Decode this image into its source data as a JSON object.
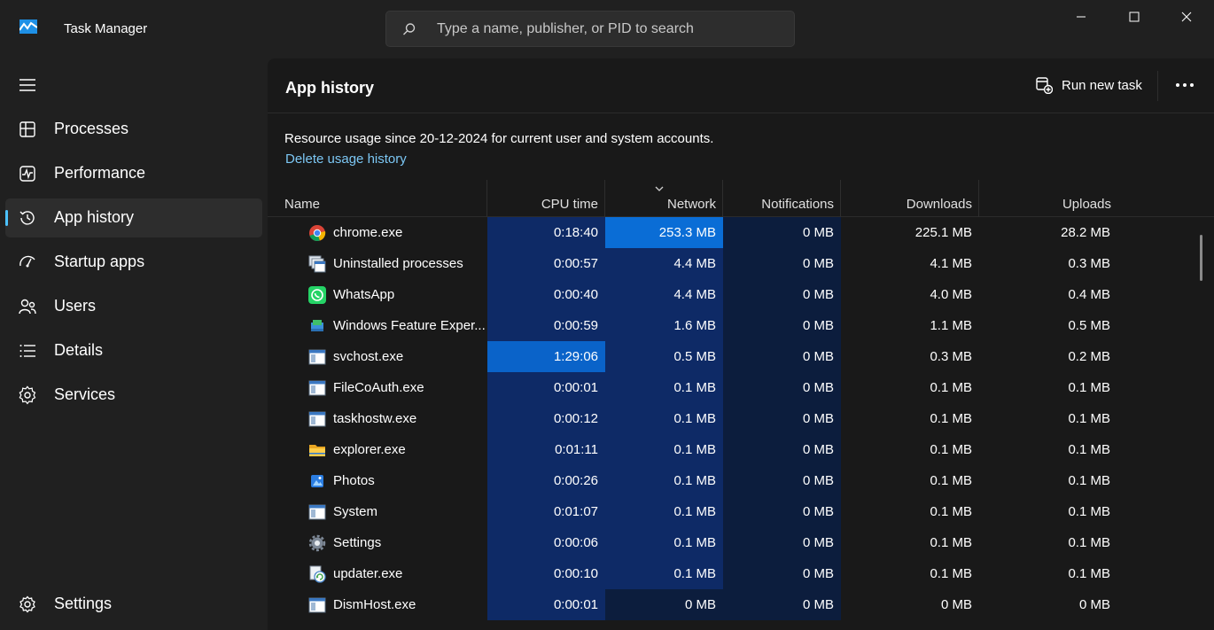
{
  "window": {
    "title": "Task Manager",
    "search_placeholder": "Type a name, publisher, or PID to search"
  },
  "nav": {
    "items": [
      {
        "label": "Processes",
        "icon": "processes-icon"
      },
      {
        "label": "Performance",
        "icon": "performance-icon"
      },
      {
        "label": "App history",
        "icon": "history-icon",
        "active": true
      },
      {
        "label": "Startup apps",
        "icon": "startup-icon"
      },
      {
        "label": "Users",
        "icon": "users-icon"
      },
      {
        "label": "Details",
        "icon": "details-icon"
      },
      {
        "label": "Services",
        "icon": "services-icon"
      }
    ],
    "settings_label": "Settings"
  },
  "header": {
    "title": "App history",
    "run_new_task": "Run new task"
  },
  "info": {
    "text": "Resource usage since 20-12-2024 for current user and system accounts.",
    "delete_link": "Delete usage history"
  },
  "table": {
    "columns": [
      "Name",
      "CPU time",
      "Network",
      "Notifications",
      "Downloads",
      "Uploads"
    ],
    "sorted_column": "Network",
    "rows": [
      {
        "name": "chrome.exe",
        "icon": "chrome-icon",
        "cpu": "0:18:40",
        "network": "253.3 MB",
        "notifications": "0 MB",
        "downloads": "225.1 MB",
        "uploads": "28.2 MB"
      },
      {
        "name": "Uninstalled processes",
        "icon": "uninstalled-icon",
        "cpu": "0:00:57",
        "network": "4.4 MB",
        "notifications": "0 MB",
        "downloads": "4.1 MB",
        "uploads": "0.3 MB"
      },
      {
        "name": "WhatsApp",
        "icon": "whatsapp-icon",
        "cpu": "0:00:40",
        "network": "4.4 MB",
        "notifications": "0 MB",
        "downloads": "4.0 MB",
        "uploads": "0.4 MB"
      },
      {
        "name": "Windows Feature Exper...",
        "icon": "feature-experience-icon",
        "cpu": "0:00:59",
        "network": "1.6 MB",
        "notifications": "0 MB",
        "downloads": "1.1 MB",
        "uploads": "0.5 MB"
      },
      {
        "name": "svchost.exe",
        "icon": "window-app-icon",
        "cpu": "1:29:06",
        "network": "0.5 MB",
        "notifications": "0 MB",
        "downloads": "0.3 MB",
        "uploads": "0.2 MB"
      },
      {
        "name": "FileCoAuth.exe",
        "icon": "window-app-icon",
        "cpu": "0:00:01",
        "network": "0.1 MB",
        "notifications": "0 MB",
        "downloads": "0.1 MB",
        "uploads": "0.1 MB"
      },
      {
        "name": "taskhostw.exe",
        "icon": "window-app-icon",
        "cpu": "0:00:12",
        "network": "0.1 MB",
        "notifications": "0 MB",
        "downloads": "0.1 MB",
        "uploads": "0.1 MB"
      },
      {
        "name": "explorer.exe",
        "icon": "folder-icon",
        "cpu": "0:01:11",
        "network": "0.1 MB",
        "notifications": "0 MB",
        "downloads": "0.1 MB",
        "uploads": "0.1 MB"
      },
      {
        "name": "Photos",
        "icon": "photos-icon",
        "cpu": "0:00:26",
        "network": "0.1 MB",
        "notifications": "0 MB",
        "downloads": "0.1 MB",
        "uploads": "0.1 MB"
      },
      {
        "name": "System",
        "icon": "window-app-icon",
        "cpu": "0:01:07",
        "network": "0.1 MB",
        "notifications": "0 MB",
        "downloads": "0.1 MB",
        "uploads": "0.1 MB"
      },
      {
        "name": "Settings",
        "icon": "settings-gear-icon",
        "cpu": "0:00:06",
        "network": "0.1 MB",
        "notifications": "0 MB",
        "downloads": "0.1 MB",
        "uploads": "0.1 MB"
      },
      {
        "name": "updater.exe",
        "icon": "updater-icon",
        "cpu": "0:00:10",
        "network": "0.1 MB",
        "notifications": "0 MB",
        "downloads": "0.1 MB",
        "uploads": "0.1 MB"
      },
      {
        "name": "DismHost.exe",
        "icon": "window-app-icon",
        "cpu": "0:00:01",
        "network": "0 MB",
        "notifications": "0 MB",
        "downloads": "0 MB",
        "uploads": "0 MB"
      }
    ]
  },
  "colors": {
    "heat_dark": "#0c1d3d",
    "heat_mid": "#0e2a66",
    "heat_strong": "#0a4bb0",
    "heat_max": "#0a63c9",
    "accent": "#4cc2ff",
    "link": "#7cc7f4"
  }
}
